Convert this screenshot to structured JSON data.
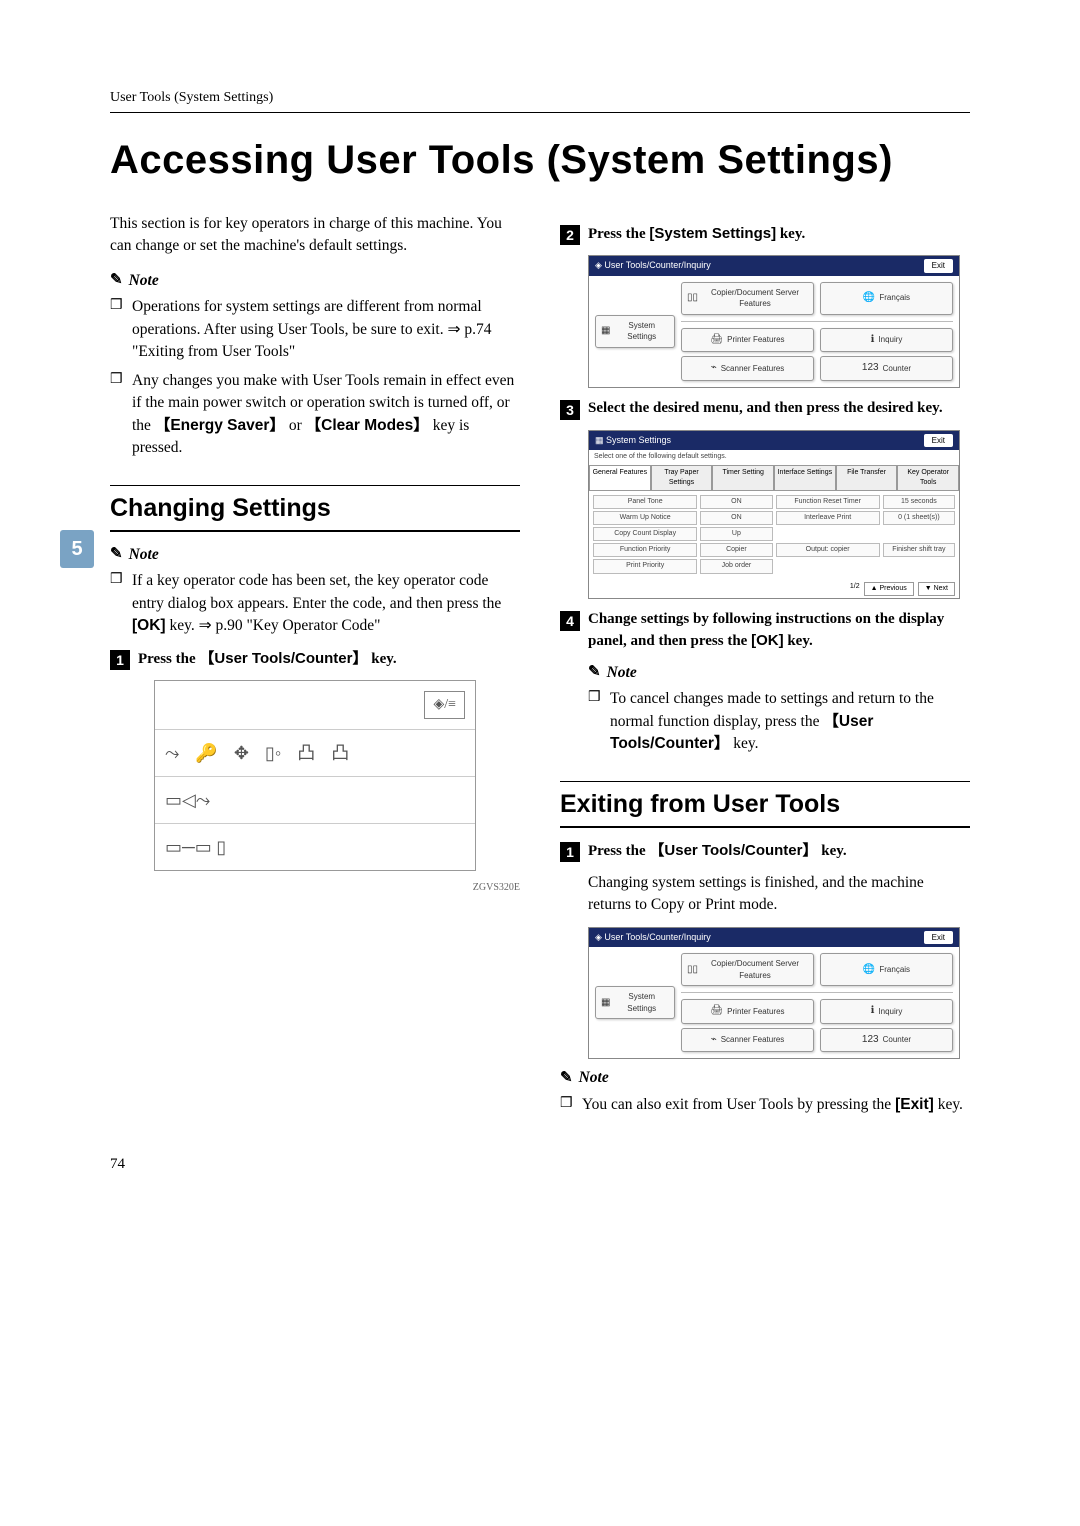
{
  "header": "User Tools (System Settings)",
  "title": "Accessing User Tools (System Settings)",
  "intro": "This section is for key operators in charge of this machine. You can change or set the machine's default settings.",
  "note_label": "Note",
  "left_notes": [
    "Operations for system settings are different from normal operations. After using User Tools, be sure to exit. ⇒ p.74 \"Exiting from User Tools\"",
    "Any changes you make with User Tools remain in effect even if the main power switch or operation switch is turned off, or the "
  ],
  "note1_tail_a": "Energy Saver",
  "note1_tail_mid": " or ",
  "note1_tail_b": "Clear Modes",
  "note1_tail_end": " key is pressed.",
  "changing_title": "Changing Settings",
  "changing_note": "If a key operator code has been set, the key operator code entry dialog box appears. Enter the code, and then press the ",
  "ok_key": "[OK]",
  "changing_note_end": " key. ⇒ p.90 \"Key Operator Code\"",
  "step1": "Press the ",
  "step1_key": "User Tools/Counter",
  "step1_tail": " key.",
  "cp_caption": "ZGVS320E",
  "r_step2": "Press the ",
  "r_step2_key": "[System Settings]",
  "r_step2_tail": " key.",
  "r_step3": "Select the desired menu, and then press the desired key.",
  "r_step4": "Change settings by following instructions on the display panel, and then press the ",
  "r_step4_tail": " key.",
  "r_step4_note": "To cancel changes made to settings and return to the normal function display, press the ",
  "r_step4_note_key": "User Tools/Counter",
  "r_step4_note_tail": " key.",
  "exit_title": "Exiting from User Tools",
  "exit_step1": "Press the ",
  "exit_step1_key": "User Tools/Counter",
  "exit_step1_tail": " key.",
  "exit_body": "Changing system settings is finished, and the machine returns to Copy or Print mode.",
  "exit_note": "You can also exit from User Tools by pressing the ",
  "exit_note_key": "[Exit]",
  "exit_note_tail": " key.",
  "page_number": "74",
  "tab_number": "5",
  "utci": {
    "title": "User Tools/Counter/Inquiry",
    "exit": "Exit",
    "system_settings": "System Settings",
    "copier_doc": "Copier/Document Server Features",
    "francais": "Français",
    "printer": "Printer Features",
    "inquiry": "Inquiry",
    "scanner": "Scanner Features",
    "counter": "Counter"
  },
  "sys": {
    "title": "System Settings",
    "sub": "Select one of the following default settings.",
    "tabs": [
      "General Features",
      "Tray Paper Settings",
      "Timer Setting",
      "Interface Settings",
      "File Transfer",
      "Key Operator Tools"
    ],
    "rows": [
      {
        "l": "Panel Tone",
        "v": "ON",
        "l2": "Function Reset Timer",
        "v2": "15 seconds"
      },
      {
        "l": "Warm Up Notice",
        "v": "ON",
        "l2": "Interleave Print",
        "v2": "0 (1 sheet(s))"
      },
      {
        "l": "Copy Count Display",
        "v": "Up",
        "l2": "",
        "v2": ""
      },
      {
        "l": "Function Priority",
        "v": "Copier",
        "l2": "Output: copier",
        "v2": "Finisher shift tray"
      },
      {
        "l": "Print Priority",
        "v": "Job order",
        "l2": "",
        "v2": ""
      }
    ],
    "footer_page": "1/2",
    "prev": "▲ Previous",
    "next": "▼ Next"
  },
  "cp_topright_glyph": "◈/≡"
}
